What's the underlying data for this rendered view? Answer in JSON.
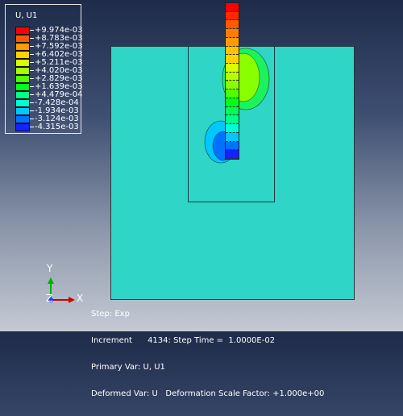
{
  "legend": {
    "title": "U, U1",
    "entries": [
      {
        "label": "+9.974e-03",
        "color": "#ff0000"
      },
      {
        "label": "+8.783e-03",
        "color": "#ff5a00"
      },
      {
        "label": "+7.592e-03",
        "color": "#ff9a00"
      },
      {
        "label": "+6.402e-03",
        "color": "#ffd200"
      },
      {
        "label": "+5.211e-03",
        "color": "#d7ff00"
      },
      {
        "label": "+4.020e-03",
        "color": "#a4ff00"
      },
      {
        "label": "+2.829e-03",
        "color": "#50ff00"
      },
      {
        "label": "+1.639e-03",
        "color": "#00ff16"
      },
      {
        "label": "+4.479e-04",
        "color": "#00ff8b"
      },
      {
        "label": "-7.428e-04",
        "color": "#00ffd6"
      },
      {
        "label": "-1.934e-03",
        "color": "#00c8ff"
      },
      {
        "label": "-3.124e-03",
        "color": "#0072ff"
      },
      {
        "label": "-4.315e-03",
        "color": "#1322ff"
      }
    ]
  },
  "triad": {
    "y": "Y",
    "z": "Z",
    "x": "X"
  },
  "info": {
    "step_label": "Step:",
    "step_value": "Exp",
    "increment_label": "Increment",
    "increment_value": "4134:",
    "steptime_label": "Step Time =",
    "steptime_value": "1.0000E-02",
    "primary_label": "Primary Var:",
    "primary_value": "U, U1",
    "deformed_label": "Deformed Var:",
    "deformed_value": "U",
    "scale_label": "Deformation Scale Factor:",
    "scale_value": "+1.000e+00"
  },
  "colors": {
    "part": "#2fd6c7",
    "band": [
      "#ff0000",
      "#ff2a00",
      "#ff5a00",
      "#ff7d00",
      "#ff9a00",
      "#ffc300",
      "#ffd200",
      "#d7ff00",
      "#b5ff00",
      "#8aff00",
      "#50ff00",
      "#00ff16",
      "#00ff55",
      "#00ff8b",
      "#00ffd6",
      "#00c8ff",
      "#0072ff",
      "#1322ff"
    ]
  }
}
